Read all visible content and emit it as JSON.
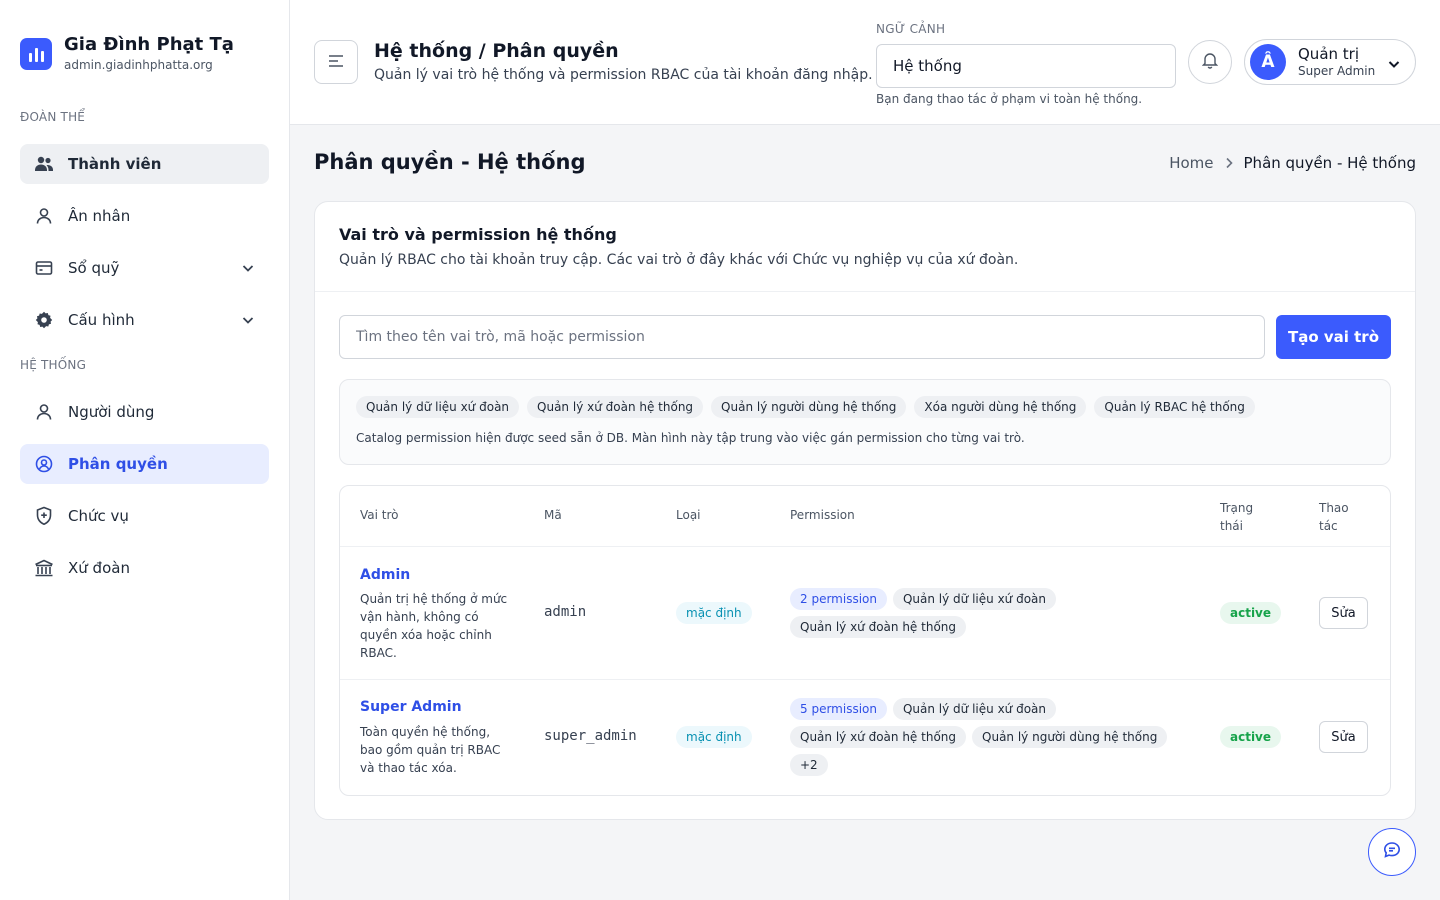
{
  "brand": {
    "name": "Gia Đình Phạt Tạ",
    "domain": "admin.giadinhphatta.org"
  },
  "sidebar": {
    "section1": "ĐOÀN THỂ",
    "section2": "HỆ THỐNG",
    "items": [
      {
        "label": "Thành viên",
        "icon": "users-icon"
      },
      {
        "label": "Ân nhân",
        "icon": "user-icon"
      },
      {
        "label": "Sổ quỹ",
        "icon": "wallet-icon"
      },
      {
        "label": "Cấu hình",
        "icon": "gear-icon"
      },
      {
        "label": "Người dùng",
        "icon": "user-icon"
      },
      {
        "label": "Phân quyền",
        "icon": "user-circle-icon"
      },
      {
        "label": "Chức vụ",
        "icon": "shield-icon"
      },
      {
        "label": "Xứ đoàn",
        "icon": "building-icon"
      }
    ]
  },
  "header": {
    "title": "Hệ thống / Phân quyền",
    "subtitle": "Quản lý vai trò hệ thống và permission RBAC của tài khoản đăng nhập.",
    "context_label": "NGỮ CẢNH",
    "context_value": "Hệ thống",
    "context_note": "Bạn đang thao tác ở phạm vi toàn hệ thống.",
    "user": {
      "initial": "Â",
      "name": "Quản trị",
      "role": "Super Admin"
    }
  },
  "page": {
    "title": "Phân quyền - Hệ thống",
    "breadcrumb_home": "Home",
    "breadcrumb_current": "Phân quyền - Hệ thống"
  },
  "card": {
    "title": "Vai trò và permission hệ thống",
    "subtitle": "Quản lý RBAC cho tài khoản truy cập. Các vai trò ở đây khác với Chức vụ nghiệp vụ của xứ đoàn.",
    "search_placeholder": "Tìm theo tên vai trò, mã hoặc permission",
    "create_label": "Tạo vai trò",
    "catalog_tags": [
      "Quản lý dữ liệu xứ đoàn",
      "Quản lý xứ đoàn hệ thống",
      "Quản lý người dùng hệ thống",
      "Xóa người dùng hệ thống",
      "Quản lý RBAC hệ thống"
    ],
    "catalog_note": "Catalog permission hiện được seed sẵn ở DB. Màn hình này tập trung vào việc gán permission cho từng vai trò."
  },
  "table": {
    "headers": {
      "role": "Vai trò",
      "code": "Mã",
      "type": "Loại",
      "permission": "Permission",
      "status": "Trạng thái",
      "actions": "Thao tác"
    },
    "rows": [
      {
        "name": "Admin",
        "description": "Quản trị hệ thống ở mức vận hành, không có quyền xóa hoặc chỉnh RBAC.",
        "code": "admin",
        "type": "mặc định",
        "perm_count": "2 permission",
        "permissions": [
          "Quản lý dữ liệu xứ đoàn",
          "Quản lý xứ đoàn hệ thống"
        ],
        "status": "active",
        "edit_label": "Sửa"
      },
      {
        "name": "Super Admin",
        "description": "Toàn quyền hệ thống, bao gồm quản trị RBAC và thao tác xóa.",
        "code": "super_admin",
        "type": "mặc định",
        "perm_count": "5 permission",
        "permissions": [
          "Quản lý dữ liệu xứ đoàn",
          "Quản lý xứ đoàn hệ thống",
          "Quản lý người dùng hệ thống",
          "+2"
        ],
        "status": "active",
        "edit_label": "Sửa"
      }
    ]
  },
  "colors": {
    "accent": "#3b5bfd",
    "active_status": "#16a34a",
    "type_badge": "#0891b2"
  }
}
